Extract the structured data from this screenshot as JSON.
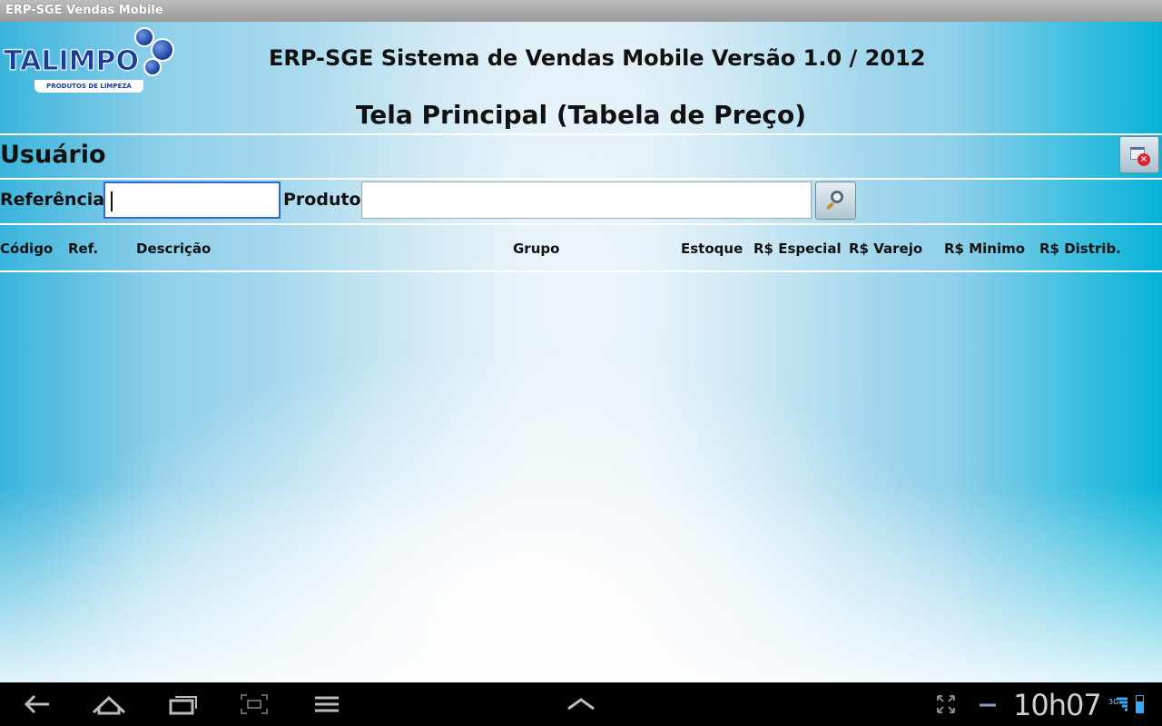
{
  "window": {
    "title": "ERP-SGE Vendas Mobile"
  },
  "logo": {
    "name": "TALIMPO",
    "tagline": "PRODUTOS DE LIMPEZA"
  },
  "header": {
    "app_title": "ERP-SGE Sistema de Vendas Mobile Versão 1.0 / 2012",
    "screen_title": "Tela Principal (Tabela de Preço)"
  },
  "user": {
    "label": "Usuário",
    "close_icon": "close-window-icon"
  },
  "search": {
    "referencia_label": "Referência:",
    "referencia_value": "",
    "produto_label": "Produto:",
    "produto_value": "",
    "search_icon": "magnifier-icon"
  },
  "table": {
    "columns": [
      "Código",
      "Ref.",
      "Descrição",
      "Grupo",
      "Estoque",
      "R$ Especial",
      "R$ Varejo",
      "R$ Minimo",
      "R$ Distrib."
    ],
    "rows": []
  },
  "system_bar": {
    "time": "10h07",
    "network": "3G",
    "icons": [
      "back-icon",
      "home-icon",
      "recent-apps-icon",
      "screenshot-icon",
      "menu-icon",
      "chevron-up-icon",
      "fullscreen-icon",
      "minimize-icon",
      "signal-icon",
      "battery-icon"
    ]
  },
  "colors": {
    "accent": "#1a3d9a",
    "background_edge": "#06b2d8",
    "focus": "#2f6bd0"
  }
}
